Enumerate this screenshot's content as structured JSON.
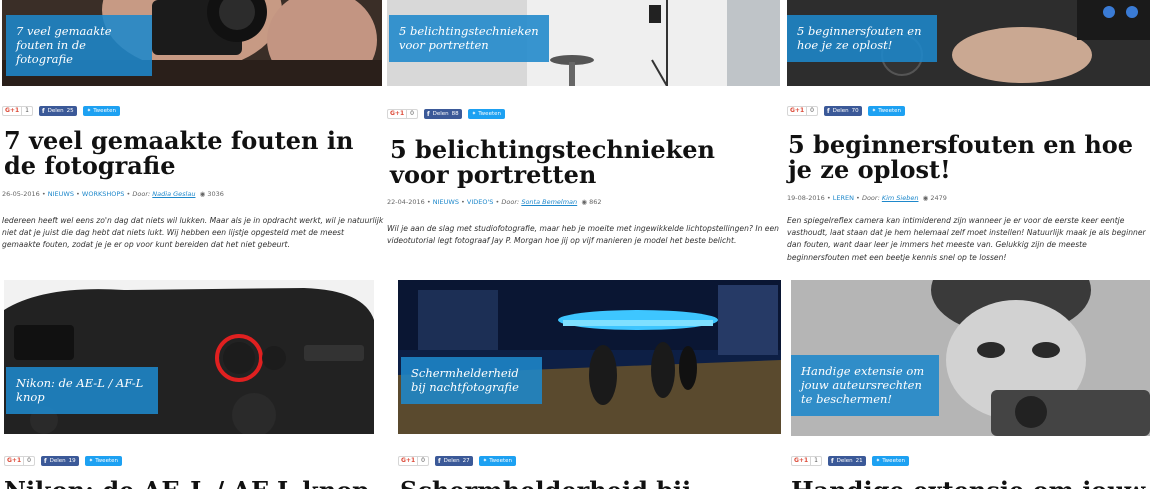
{
  "colors": {
    "accent": "#1e88cb",
    "facebook": "#3b5998",
    "twitter": "#1da1f2",
    "gplus": "#dd4b39"
  },
  "social_labels": {
    "gplus": "G+1",
    "facebook_prefix": "Delen",
    "twitter": "Tweeten"
  },
  "row1": [
    {
      "thumb_caption": "7 veel gemaakte fouten in de fotografie",
      "gplus_count": "1",
      "fb_count": "25",
      "title": "7 veel gemaakte fouten in de fotografie",
      "date": "26-05-2016",
      "categories": [
        "NIEUWS",
        "WORKSHOPS"
      ],
      "by_label": "Door:",
      "author": "Nadia Geslau",
      "views": "3036",
      "excerpt": "Iedereen heeft wel eens zo'n dag dat niets wil lukken. Maar als je in opdracht werkt, wil je natuurlijk niet dat je juist die dag hebt dat niets lukt. Wij hebben een lijstje opgesteld met de meest gemaakte fouten, zodat je je er op voor kunt bereiden dat het niet gebeurt."
    },
    {
      "thumb_caption": "5 belichtingstechnieken voor portretten",
      "gplus_count": "0",
      "fb_count": "88",
      "title": "5 belichtingstechnieken voor portretten",
      "date": "22-04-2016",
      "categories": [
        "NIEUWS",
        "VIDEO'S"
      ],
      "by_label": "Door:",
      "author": "Sonta Bemelman",
      "views": "862",
      "excerpt": "Wil je aan de slag met studiofotografie, maar heb je moeite met ingewikkelde lichtopstellingen? In een videotutorial legt fotograaf Jay P. Morgan hoe jij op vijf manieren je model het beste belicht."
    },
    {
      "thumb_caption": "5 beginnersfouten en hoe je ze oplost!",
      "gplus_count": "0",
      "fb_count": "70",
      "title": "5 beginnersfouten en hoe je ze oplost!",
      "date": "19-08-2016",
      "categories": [
        "LEREN"
      ],
      "by_label": "Door:",
      "author": "Kim Sieben",
      "views": "2479",
      "excerpt": "Een spiegelreflex camera kan intimiderend zijn wanneer je er voor de eerste keer eentje vasthoudt, laat staan dat je hem helemaal zelf moet instellen! Natuurlijk maak je als beginner dan fouten, want daar leer je immers het meeste van. Gelukkig zijn de meeste beginnersfouten met een beetje kennis snel op te lossen!"
    }
  ],
  "row2": [
    {
      "thumb_caption": "Nikon: de AE-L / AF-L knop",
      "gplus_count": "0",
      "fb_count": "19",
      "title": "Nikon: de AE-L / AF-L knop"
    },
    {
      "thumb_caption": "Schermhelderheid bij nachtfotografie",
      "gplus_count": "0",
      "fb_count": "27",
      "title": "Schermhelderheid bij"
    },
    {
      "thumb_caption": "Handige extensie om jouw auteursrechten te beschermen!",
      "gplus_count": "1",
      "fb_count": "21",
      "title": "Handige extensie om jouw"
    }
  ],
  "icons": {
    "views": "eye-icon",
    "facebook": "facebook-icon",
    "twitter": "twitter-bird-icon"
  }
}
